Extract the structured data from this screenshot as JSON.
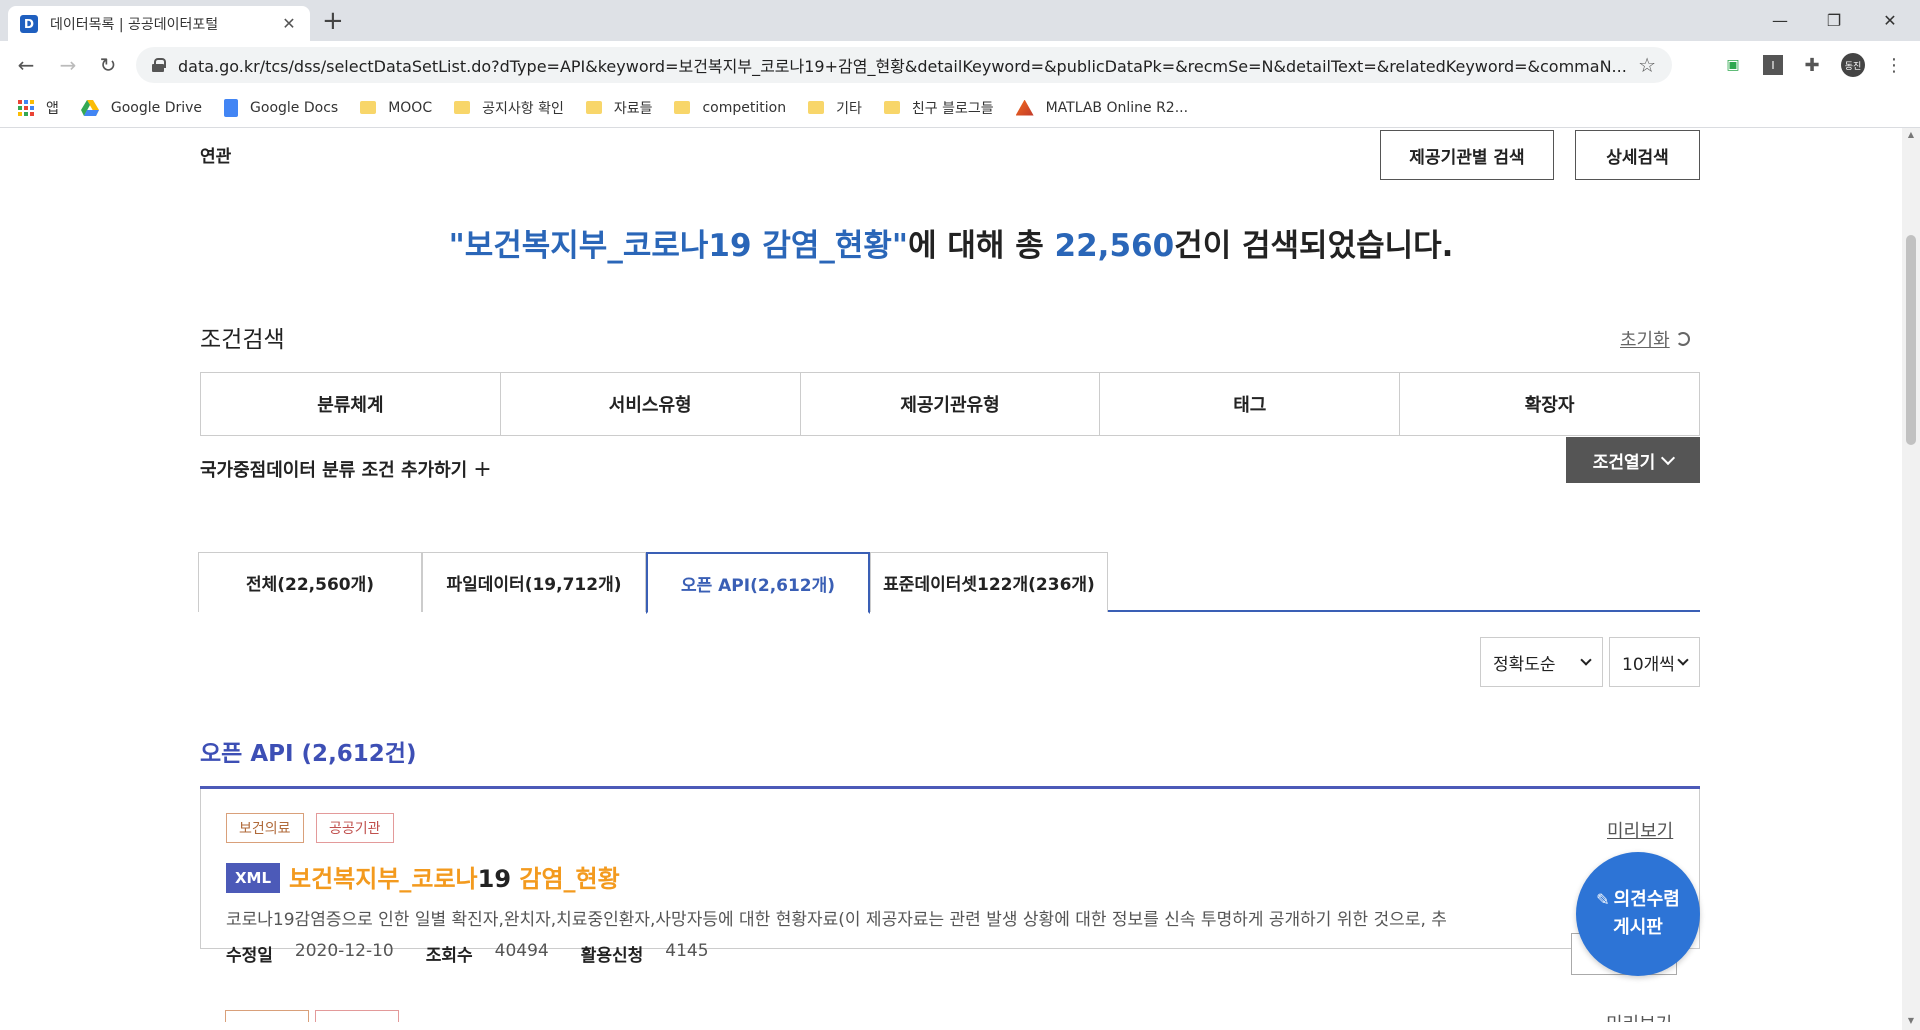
{
  "browser": {
    "tab_title": "데이터목록 | 공공데이터포털",
    "tab_favicon_letter": "D",
    "url": "data.go.kr/tcs/dss/selectDataSetList.do?dType=API&keyword=보건복지부_코로나19+감염_현황&detailKeyword=&publicDataPk=&recmSe=N&detailText=&relatedKeyword=&commaN...",
    "profile_initials": "동진",
    "bookmarks": [
      {
        "label": "앱",
        "icon": "apps-grid-icon"
      },
      {
        "label": "Google Drive",
        "icon": "google-drive-icon"
      },
      {
        "label": "Google Docs",
        "icon": "google-docs-icon"
      },
      {
        "label": "MOOC",
        "icon": "folder-icon"
      },
      {
        "label": "공지사항 확인",
        "icon": "folder-icon"
      },
      {
        "label": "자료들",
        "icon": "folder-icon"
      },
      {
        "label": "competition",
        "icon": "folder-icon"
      },
      {
        "label": "기타",
        "icon": "folder-icon"
      },
      {
        "label": "친구 블로그들",
        "icon": "folder-icon"
      },
      {
        "label": "MATLAB Online R2...",
        "icon": "matlab-icon"
      }
    ]
  },
  "search": {
    "related_label": "연관",
    "org_search_button": "제공기관별 검색",
    "detail_search_button": "상세검색",
    "headline_query": "\"보건복지부_코로나19 감염_현황\"",
    "headline_mid": "에 대해 총 ",
    "headline_count": "22,560",
    "headline_end": "건이 검색되었습니다."
  },
  "conditions": {
    "title": "조건검색",
    "reset_label": "초기화",
    "columns": [
      "분류체계",
      "서비스유형",
      "제공기관유형",
      "태그",
      "확장자"
    ],
    "national_add": "국가중점데이터 분류 조건 추가하기",
    "open_button": "조건열기"
  },
  "result_tabs": [
    {
      "label": "전체(22,560개)",
      "active": false
    },
    {
      "label": "파일데이터(19,712개)",
      "active": false
    },
    {
      "label": "오픈 API(2,612개)",
      "active": true
    },
    {
      "label": "표준데이터셋122개(236개)",
      "active": false
    }
  ],
  "sort": {
    "order_value": "정확도순",
    "per_page_value": "10개씩"
  },
  "section": {
    "title": "오픈 API (2,612건)"
  },
  "result": {
    "tags": [
      "보건의료",
      "공공기관"
    ],
    "preview_label": "미리보기",
    "format": "XML",
    "title_a": "보건복지부_코로나",
    "title_b": "19",
    "title_c": " 감염_현황",
    "description": "코로나19감염증으로 인한 일별 확진자,완치자,치료중인환자,사망자등에 대한 현황자료(이 제공자료는 관련 발생 상황에 대한 정보를 신속 투명하게 공개하기 위한 것으로, 추",
    "modified_label": "수정일",
    "modified_value": "2020-12-10",
    "views_label": "조회수",
    "views_value": "40494",
    "apply_label": "활용신청",
    "apply_value": "4145",
    "next_preview_label": "미리보기"
  },
  "fab": {
    "line1": "의견수렴",
    "line2": "게시판"
  },
  "colors": {
    "accent_blue": "#2a66b8",
    "section_purple": "#3d4fb5",
    "title_orange": "#f39a1e",
    "fab_blue": "#2d74d6"
  }
}
